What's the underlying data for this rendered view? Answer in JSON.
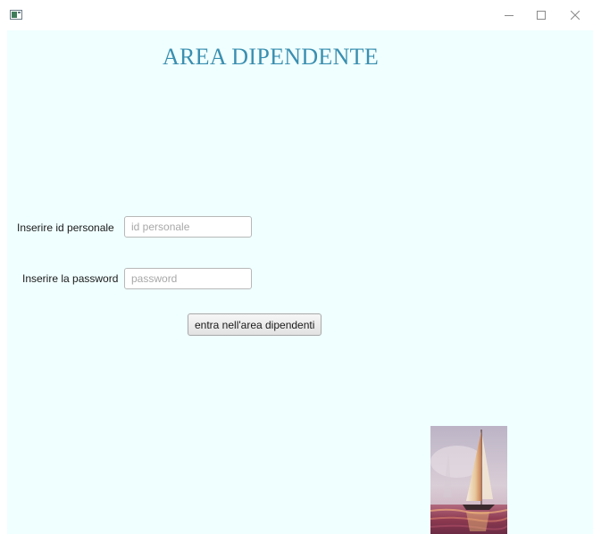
{
  "window": {
    "controls": {
      "minimize_icon": "minimize-icon",
      "maximize_icon": "maximize-icon",
      "close_icon": "close-icon"
    }
  },
  "page": {
    "title": "AREA DIPENDENTE",
    "background_color": "#f0ffff",
    "title_color": "#3a8fb0"
  },
  "form": {
    "id_label": "Inserire id personale",
    "id_placeholder": "id personale",
    "id_value": "",
    "password_label": "Inserire la password",
    "password_placeholder": "password",
    "password_value": "",
    "submit_label": "entra nell'area dipendenti"
  },
  "image": {
    "icon": "sailboat-painting"
  }
}
